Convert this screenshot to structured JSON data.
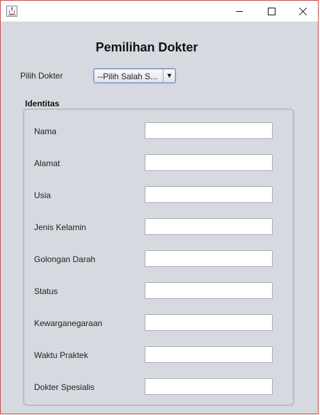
{
  "window": {
    "app_icon": "java-cup-icon",
    "controls": [
      "minimize-icon",
      "maximize-icon",
      "close-icon"
    ]
  },
  "page_title": "Pemilihan Dokter",
  "doctor_picker": {
    "label": "Pilih Dokter",
    "selected": "--Pilih Salah S...",
    "arrow_icon": "triangle-down-icon"
  },
  "identity": {
    "title": "Identitas",
    "fields": [
      {
        "label": "Nama",
        "value": ""
      },
      {
        "label": "Alamat",
        "value": ""
      },
      {
        "label": "Usia",
        "value": ""
      },
      {
        "label": "Jenis Kelamin",
        "value": ""
      },
      {
        "label": "Golongan Darah",
        "value": ""
      },
      {
        "label": "Status",
        "value": ""
      },
      {
        "label": "Kewarganegaraan",
        "value": ""
      },
      {
        "label": "Waktu Praktek",
        "value": ""
      },
      {
        "label": "Dokter Spesialis",
        "value": ""
      }
    ]
  },
  "colors": {
    "window_border": "#c64b4b",
    "window_background": "#d6d9df",
    "titlebar": "#ffffff"
  }
}
